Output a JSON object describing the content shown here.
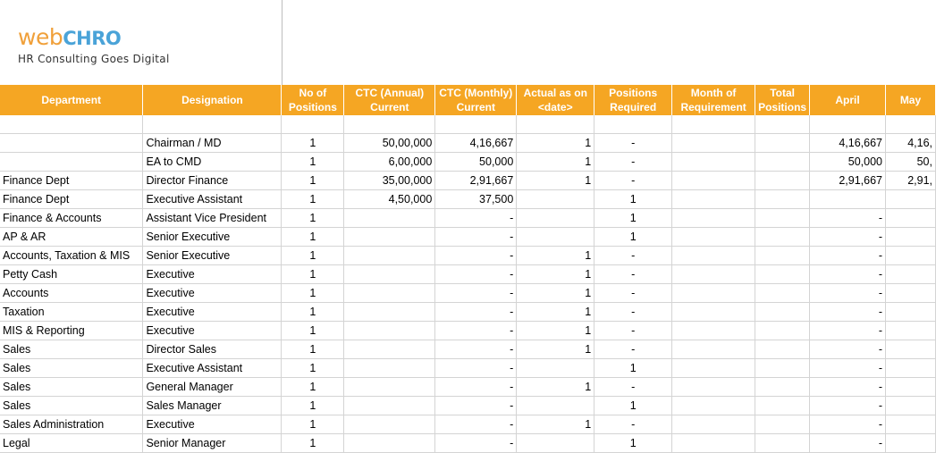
{
  "logo": {
    "web": "web",
    "chro": "CHRO",
    "tagline": "HR Consulting Goes Digital"
  },
  "headers": [
    "Department",
    "Designation",
    "No of\nPositions",
    "CTC (Annual)\nCurrent",
    "CTC (Monthly)\nCurrent",
    "Actual as on\n<date>",
    "Positions\nRequired",
    "Month of\nRequirement",
    "Total\nPositions",
    "April",
    "May"
  ],
  "rows": [
    [
      "",
      "",
      "",
      "",
      "",
      "",
      "",
      "",
      "",
      "",
      ""
    ],
    [
      "",
      "Chairman / MD",
      "1",
      "50,00,000",
      "4,16,667",
      "1",
      "-",
      "",
      "",
      "4,16,667",
      "4,16,"
    ],
    [
      "",
      "EA to CMD",
      "1",
      "6,00,000",
      "50,000",
      "1",
      "-",
      "",
      "",
      "50,000",
      "50,"
    ],
    [
      "Finance Dept",
      "Director Finance",
      "1",
      "35,00,000",
      "2,91,667",
      "1",
      "-",
      "",
      "",
      "2,91,667",
      "2,91,"
    ],
    [
      "Finance Dept",
      "Executive Assistant",
      "1",
      "4,50,000",
      "37,500",
      "",
      "1",
      "",
      "",
      "",
      ""
    ],
    [
      "Finance & Accounts",
      "Assistant Vice President",
      "1",
      "",
      "-",
      "",
      "1",
      "",
      "",
      "-",
      ""
    ],
    [
      "AP & AR",
      "Senior Executive",
      "1",
      "",
      "-",
      "",
      "1",
      "",
      "",
      "-",
      ""
    ],
    [
      "Accounts, Taxation & MIS",
      "Senior Executive",
      "1",
      "",
      "-",
      "1",
      "-",
      "",
      "",
      "-",
      ""
    ],
    [
      "Petty Cash",
      "Executive",
      "1",
      "",
      "-",
      "1",
      "-",
      "",
      "",
      "-",
      ""
    ],
    [
      "Accounts",
      "Executive",
      "1",
      "",
      "-",
      "1",
      "-",
      "",
      "",
      "-",
      ""
    ],
    [
      "Taxation",
      "Executive",
      "1",
      "",
      "-",
      "1",
      "-",
      "",
      "",
      "-",
      ""
    ],
    [
      "MIS & Reporting",
      "Executive",
      "1",
      "",
      "-",
      "1",
      "-",
      "",
      "",
      "-",
      ""
    ],
    [
      "Sales",
      "Director Sales",
      "1",
      "",
      "-",
      "1",
      "-",
      "",
      "",
      "-",
      ""
    ],
    [
      "Sales",
      "Executive Assistant",
      "1",
      "",
      "-",
      "",
      "1",
      "",
      "",
      "-",
      ""
    ],
    [
      "Sales",
      "General Manager",
      "1",
      "",
      "-",
      "1",
      "-",
      "",
      "",
      "-",
      ""
    ],
    [
      "Sales",
      "Sales Manager",
      "1",
      "",
      "-",
      "",
      "1",
      "",
      "",
      "-",
      ""
    ],
    [
      "Sales Administration",
      "Executive",
      "1",
      "",
      "-",
      "1",
      "-",
      "",
      "",
      "-",
      ""
    ],
    [
      "Legal",
      "Senior Manager",
      "1",
      "",
      "-",
      "",
      "1",
      "",
      "",
      "-",
      ""
    ]
  ]
}
